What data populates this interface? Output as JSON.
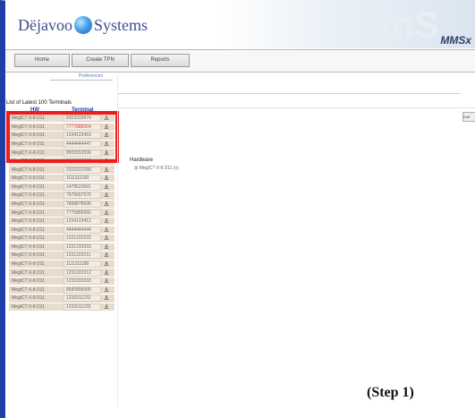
{
  "header": {
    "logo_text_left": "Dëjavoo",
    "logo_text_right": "Systems",
    "brand": "MMSx",
    "watermark": "dinS"
  },
  "nav": {
    "buttons": [
      {
        "label": "Home"
      },
      {
        "label": "Create TPN"
      },
      {
        "label": "Reports"
      }
    ],
    "pref_link": "Preferences"
  },
  "list": {
    "title": "List of Latest 100 Terminals",
    "headers": {
      "hw": "HW",
      "terminal": "Terminal"
    },
    "rows": [
      {
        "hw": "MegIC? X-8 D11",
        "terminal": "8303319974"
      },
      {
        "hw": "MegIC? X-8 D11",
        "terminal": "7777888654"
      },
      {
        "hw": "MegIC? X-8 D11",
        "terminal": "1234123453"
      },
      {
        "hw": "MegIC? X-8 D11",
        "terminal": "4444444447"
      },
      {
        "hw": "MegIC? X-8 D11",
        "terminal": "8555553599"
      },
      {
        "hw": "MegIC? X-8 D11",
        "terminal": "1444444444"
      },
      {
        "hw": "MegIC? X-8 D11",
        "terminal": "2322222299"
      },
      {
        "hw": "MegIC? X-8 D11",
        "terminal": "1111111190"
      },
      {
        "hw": "MegIC? X-8 D11",
        "terminal": "1478523691"
      },
      {
        "hw": "MegIC? X-8 D11",
        "terminal": "7675667576"
      },
      {
        "hw": "MegIC? X-8 D11",
        "terminal": "7898878598"
      },
      {
        "hw": "MegIC? X-8 D11",
        "terminal": "7775889992"
      },
      {
        "hw": "MegIC? X-8 D11",
        "terminal": "1234123412"
      },
      {
        "hw": "MegIC? X-8 D11",
        "terminal": "4444444444"
      },
      {
        "hw": "MegIC? X-8 D11",
        "terminal": "1231222222"
      },
      {
        "hw": "MegIC? X-8 D11",
        "terminal": "1231233333"
      },
      {
        "hw": "MegIC? X-8 D11",
        "terminal": "1231223211"
      },
      {
        "hw": "MegIC? X-8 D11",
        "terminal": "1111111188"
      },
      {
        "hw": "MegIC? X-8 D11",
        "terminal": "1231222212"
      },
      {
        "hw": "MegIC? X-8 D11",
        "terminal": "1233333333"
      },
      {
        "hw": "MegIC? X-8 D11",
        "terminal": "8585899999"
      },
      {
        "hw": "MegIC? X-8 D11",
        "terminal": "1233311232"
      },
      {
        "hw": "MegIC? X-8 D11",
        "terminal": "1233211233"
      }
    ],
    "red_row_index": 1
  },
  "detail": {
    "hardware_label": "Hardware",
    "hardware_item": "MegIC? X-8 D11 (x)",
    "right_button": "Edit"
  },
  "annotation": {
    "step": "(Step 1)"
  },
  "colors": {
    "frame_blue": "#1f3fa8",
    "highlight_red": "#ee1d1d",
    "row_bg": "#e8dccd"
  }
}
